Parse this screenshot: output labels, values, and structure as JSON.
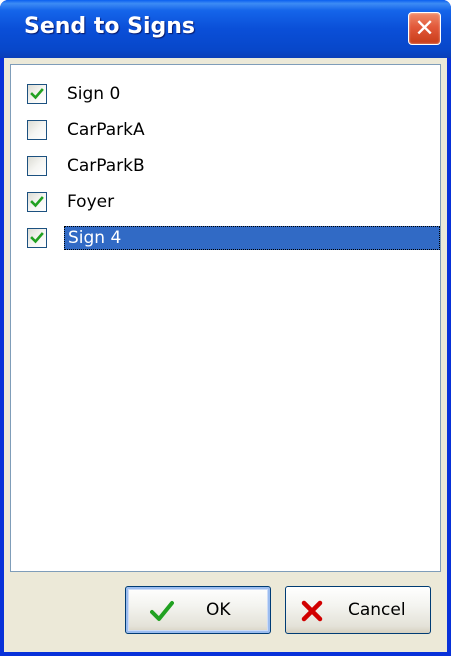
{
  "window": {
    "title": "Send to Signs",
    "close_label": "✕"
  },
  "signs": [
    {
      "label": "Sign 0",
      "checked": true,
      "selected": false
    },
    {
      "label": "CarParkA",
      "checked": false,
      "selected": false
    },
    {
      "label": "CarParkB",
      "checked": false,
      "selected": false
    },
    {
      "label": "Foyer",
      "checked": true,
      "selected": false
    },
    {
      "label": "Sign 4",
      "checked": true,
      "selected": true
    }
  ],
  "buttons": {
    "ok_label": "OK",
    "ok_icon": "check-icon",
    "cancel_label": "Cancel",
    "cancel_icon": "x-icon"
  },
  "colors": {
    "titlebar": "#0a4fd8",
    "selection": "#316ac5",
    "check": "#21a121",
    "cancel_x": "#d10000",
    "dialog_bg": "#ece9d8"
  }
}
